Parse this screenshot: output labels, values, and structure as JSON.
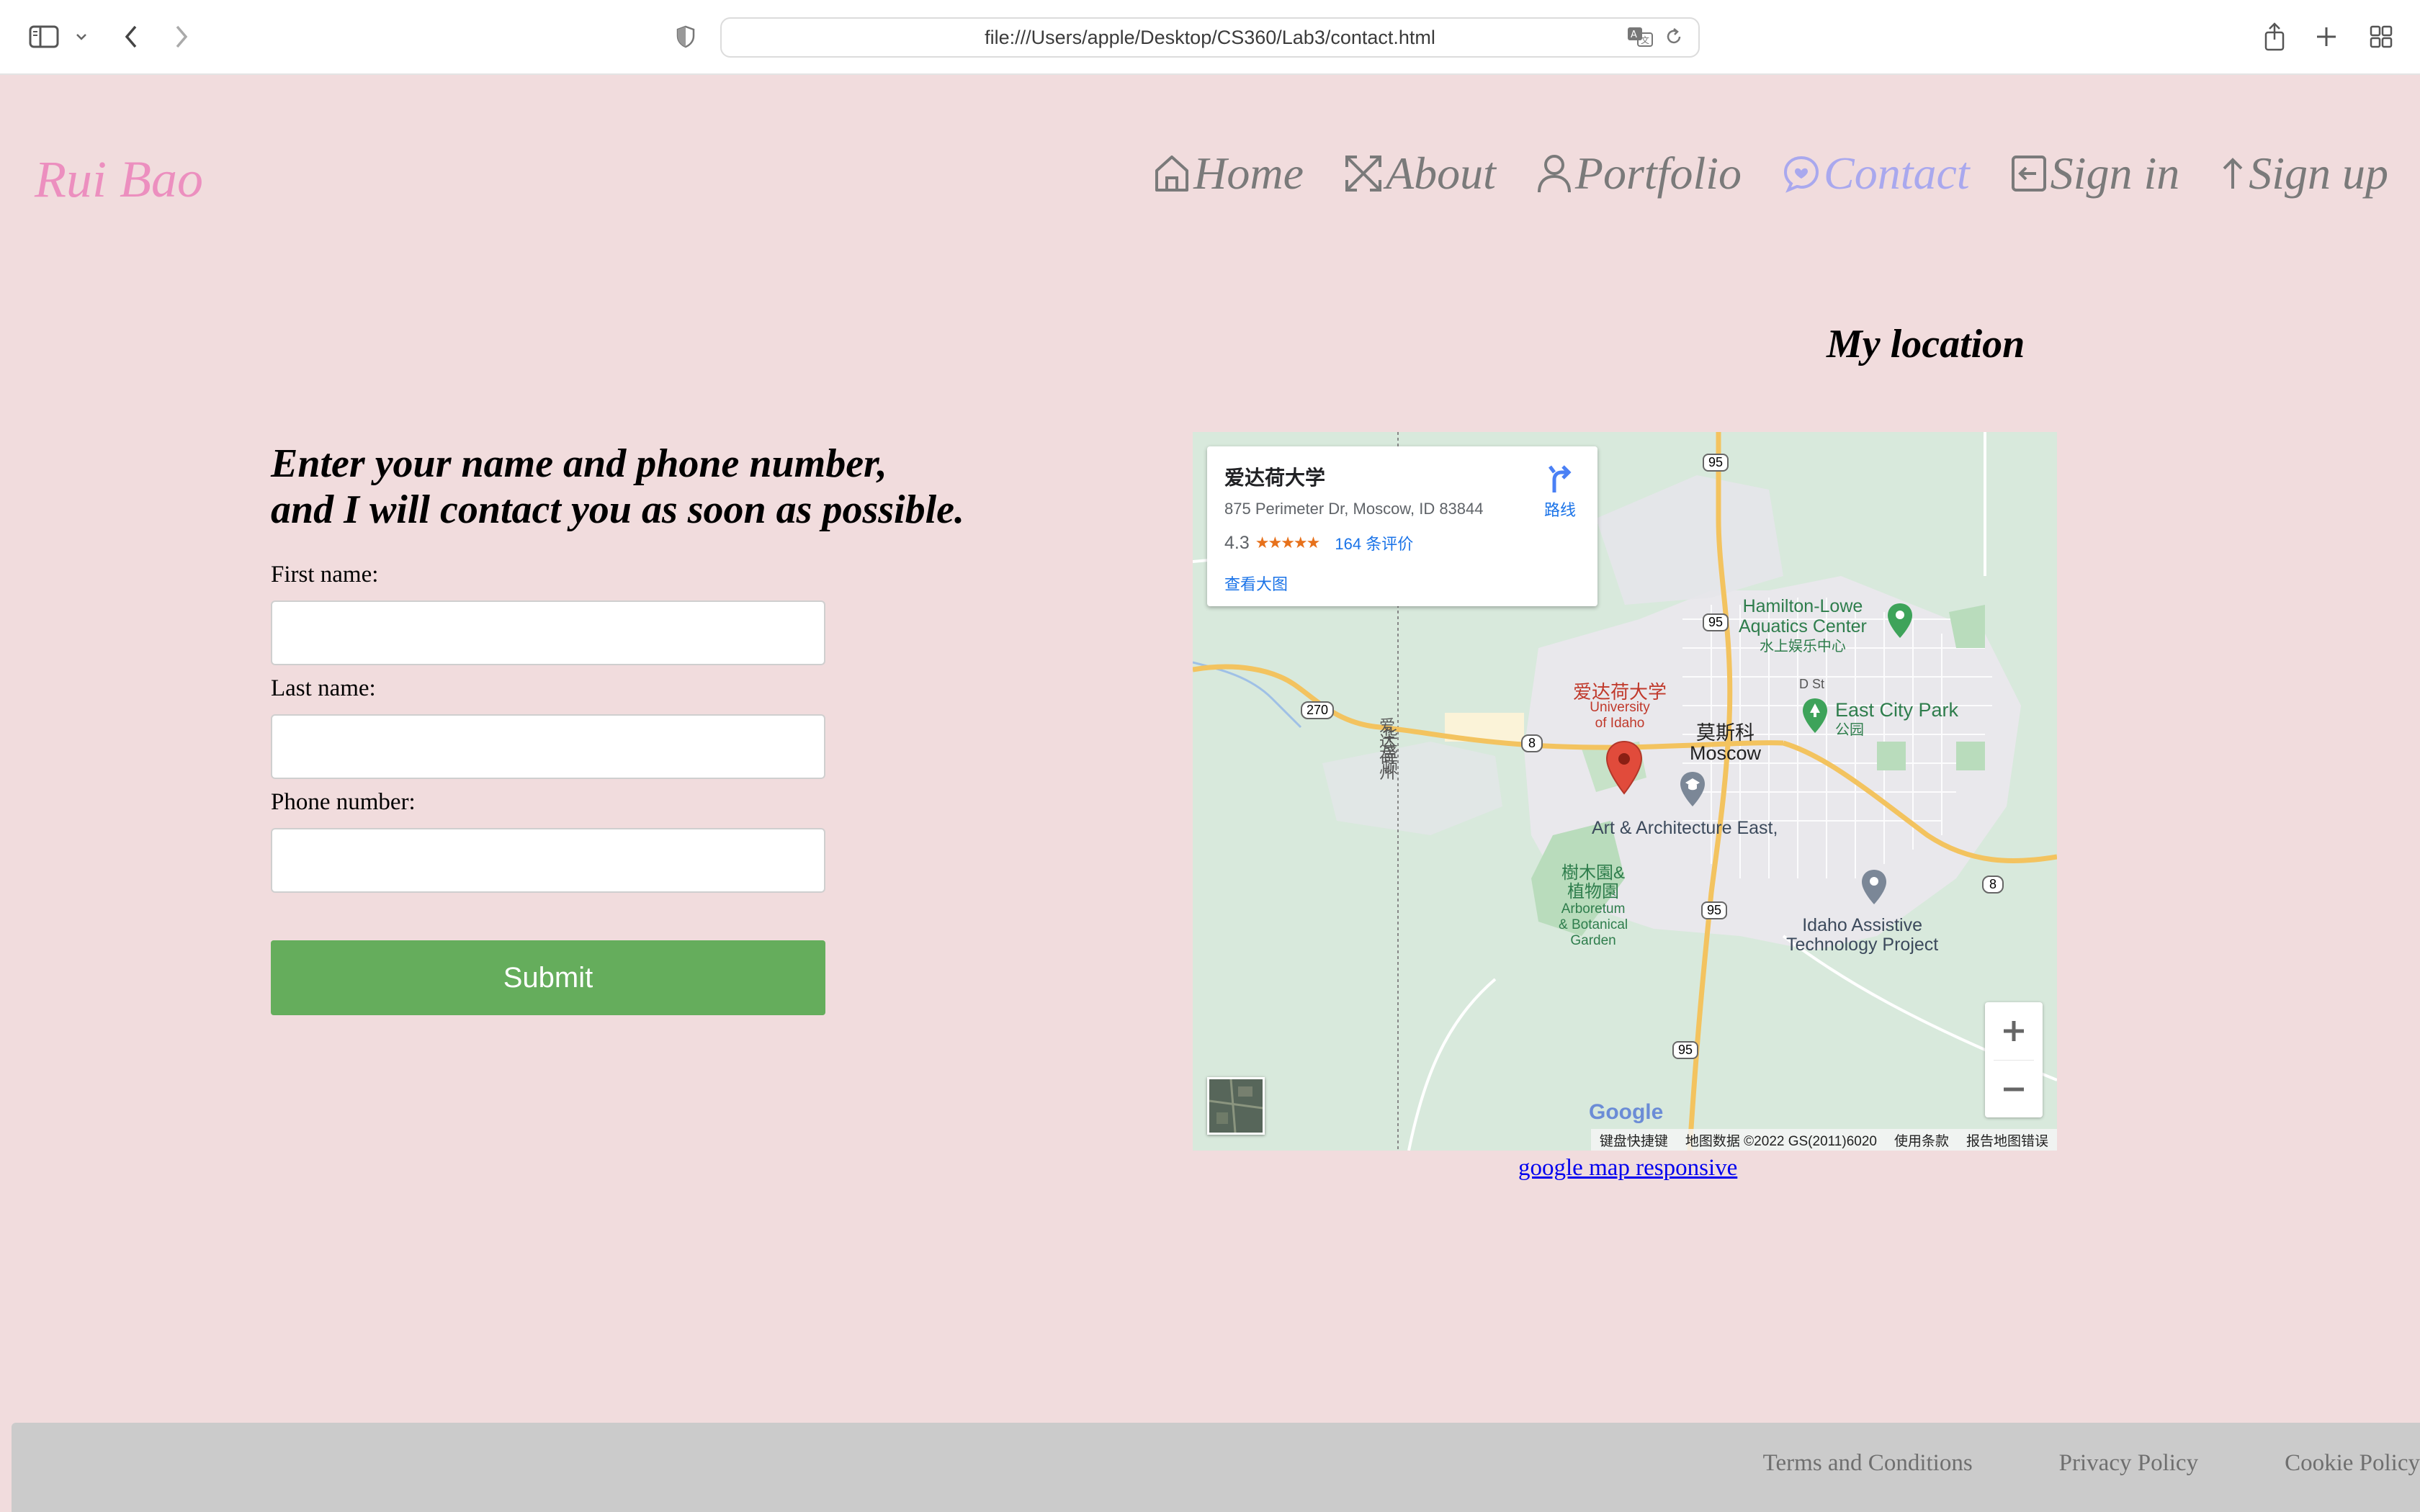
{
  "browser": {
    "url": "file:///Users/apple/Desktop/CS360/Lab3/contact.html"
  },
  "site": {
    "logo": "Rui Bao",
    "nav": [
      {
        "label": "Home",
        "icon": "home-icon"
      },
      {
        "label": "About",
        "icon": "expand-icon"
      },
      {
        "label": "Portfolio",
        "icon": "user-icon"
      },
      {
        "label": "Contact",
        "icon": "chat-icon",
        "active": true
      },
      {
        "label": "Sign in",
        "icon": "sign-in-icon"
      },
      {
        "label": "Sign up",
        "icon": "arrow-up-icon"
      }
    ],
    "active_color": "#a9a8ee"
  },
  "form": {
    "heading_line1": "Enter your name and phone number,",
    "heading_line2": "and I will contact you as soon as possible.",
    "first_name_label": "First name:",
    "last_name_label": "Last name:",
    "phone_label": "Phone number:",
    "first_name_value": "",
    "last_name_value": "",
    "phone_value": "",
    "submit_label": "Submit",
    "submit_color": "#65ad5c"
  },
  "map": {
    "title": "My location",
    "card": {
      "name": "爱达荷大学",
      "address": "875 Perimeter Dr, Moscow, ID 83844",
      "rating": "4.3",
      "stars": "★★★★★",
      "reviews": "164 条评价",
      "view_larger": "查看大图",
      "directions": "路线"
    },
    "labels": {
      "route95_a": "95",
      "route95_b": "95",
      "route95_c": "95",
      "route95_d": "95",
      "route270": "270",
      "route8_a": "8",
      "route8_b": "8",
      "hamilton": "Hamilton-Lowe",
      "aquatics": "Aquatics Center",
      "aquatics_cn": "水上娱乐中心",
      "dst": "D St",
      "east_city_park": "East City Park",
      "park_cn": "公园",
      "uidaho_cn": "爱达荷大学",
      "uidaho_en1": "University",
      "uidaho_en2": "of Idaho",
      "moscow_cn": "莫斯科",
      "moscow_en": "Moscow",
      "state_cn1": "爱达荷州",
      "state_cn2": "华盛顿",
      "art_arch": "Art & Architecture East,",
      "arboretum_cn1": "樹木園&",
      "arboretum_cn2": "植物園",
      "arboretum_en1": "Arboretum",
      "arboretum_en2": "& Botanical",
      "arboretum_en3": "Garden",
      "idaho_assistive1": "Idaho Assistive",
      "idaho_assistive2": "Technology Project",
      "google": "Google"
    },
    "attribution": [
      "键盘快捷键",
      "地图数据 ©2022 GS(2011)6020",
      "使用条款",
      "报告地图错误"
    ],
    "link": "google map responsive"
  },
  "footer": {
    "links": [
      "Terms and Conditions",
      "Privacy Policy",
      "Cookie Policy"
    ]
  }
}
